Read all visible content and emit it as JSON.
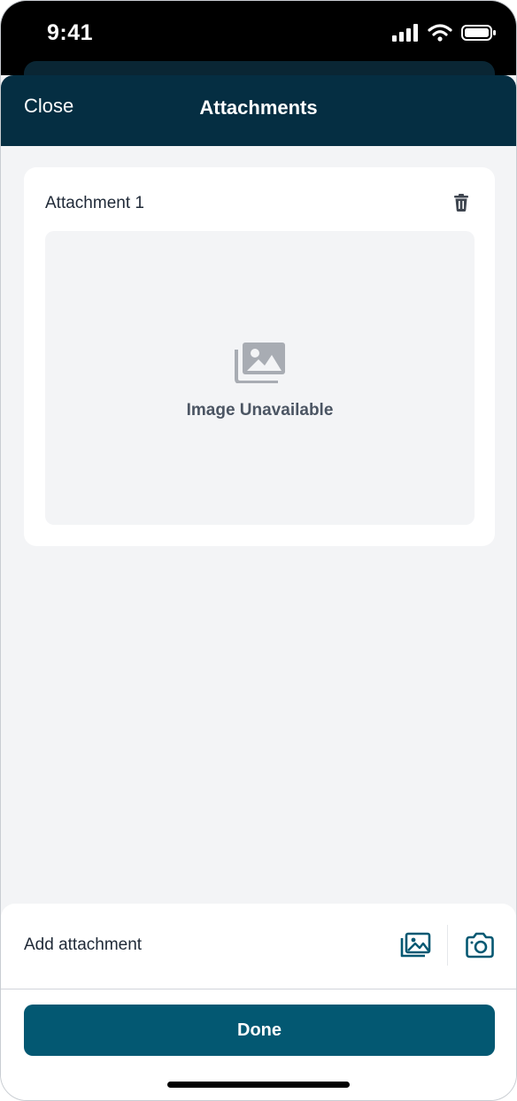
{
  "status_bar": {
    "time": "9:41"
  },
  "header": {
    "close_label": "Close",
    "title": "Attachments"
  },
  "attachments": [
    {
      "label": "Attachment 1",
      "placeholder_text": "Image Unavailable"
    }
  ],
  "footer": {
    "add_label": "Add attachment",
    "done_label": "Done"
  },
  "icons": [
    "signal-icon",
    "wifi-icon",
    "battery-icon",
    "trash-icon",
    "image-placeholder-icon",
    "gallery-icon",
    "camera-icon"
  ],
  "colors": {
    "header_bg": "#052e42",
    "accent": "#035872",
    "background": "#f3f4f6"
  }
}
